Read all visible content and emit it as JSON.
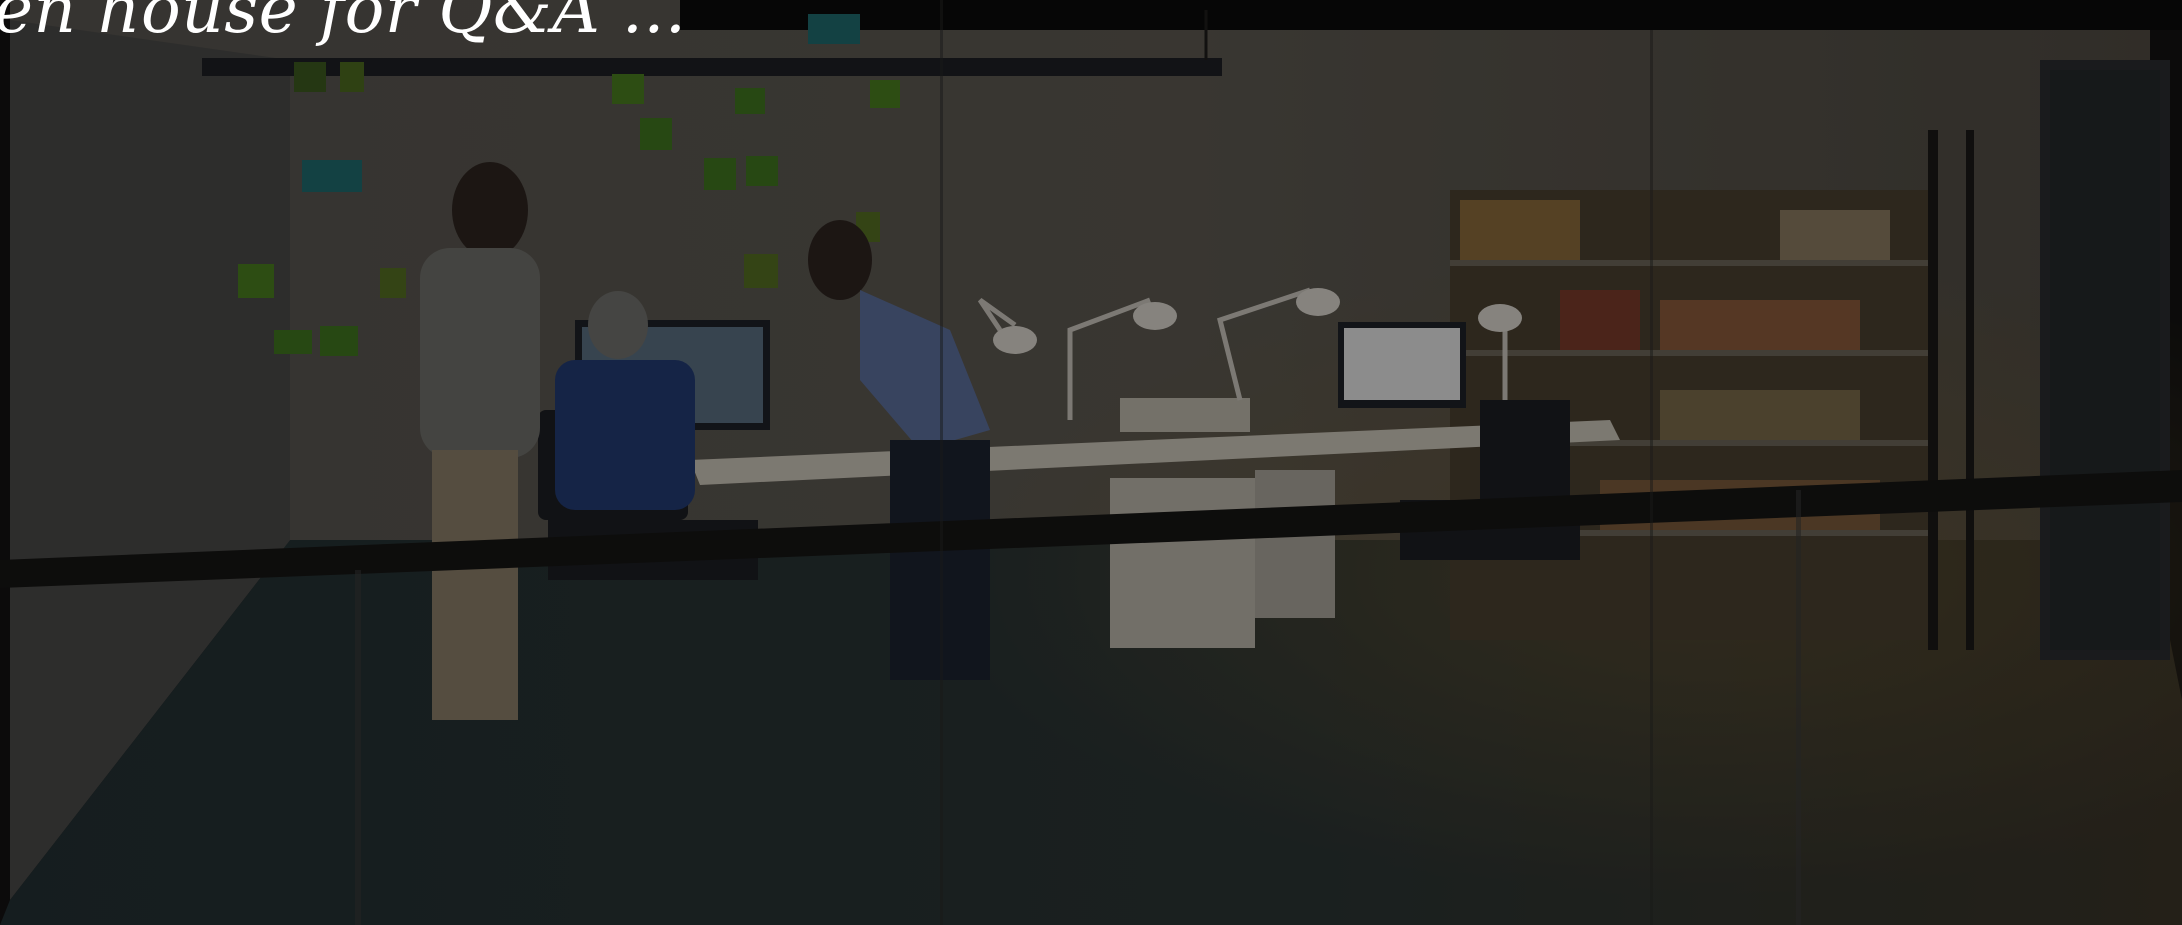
{
  "hero": {
    "title": "en house for Q&A ...",
    "image": {
      "icon": "office-photo",
      "description_colors": {
        "overlay": "#141312",
        "wall": "#5b564f",
        "floor": "#2a3232",
        "shelf_light": "#8a7a5e"
      }
    }
  }
}
